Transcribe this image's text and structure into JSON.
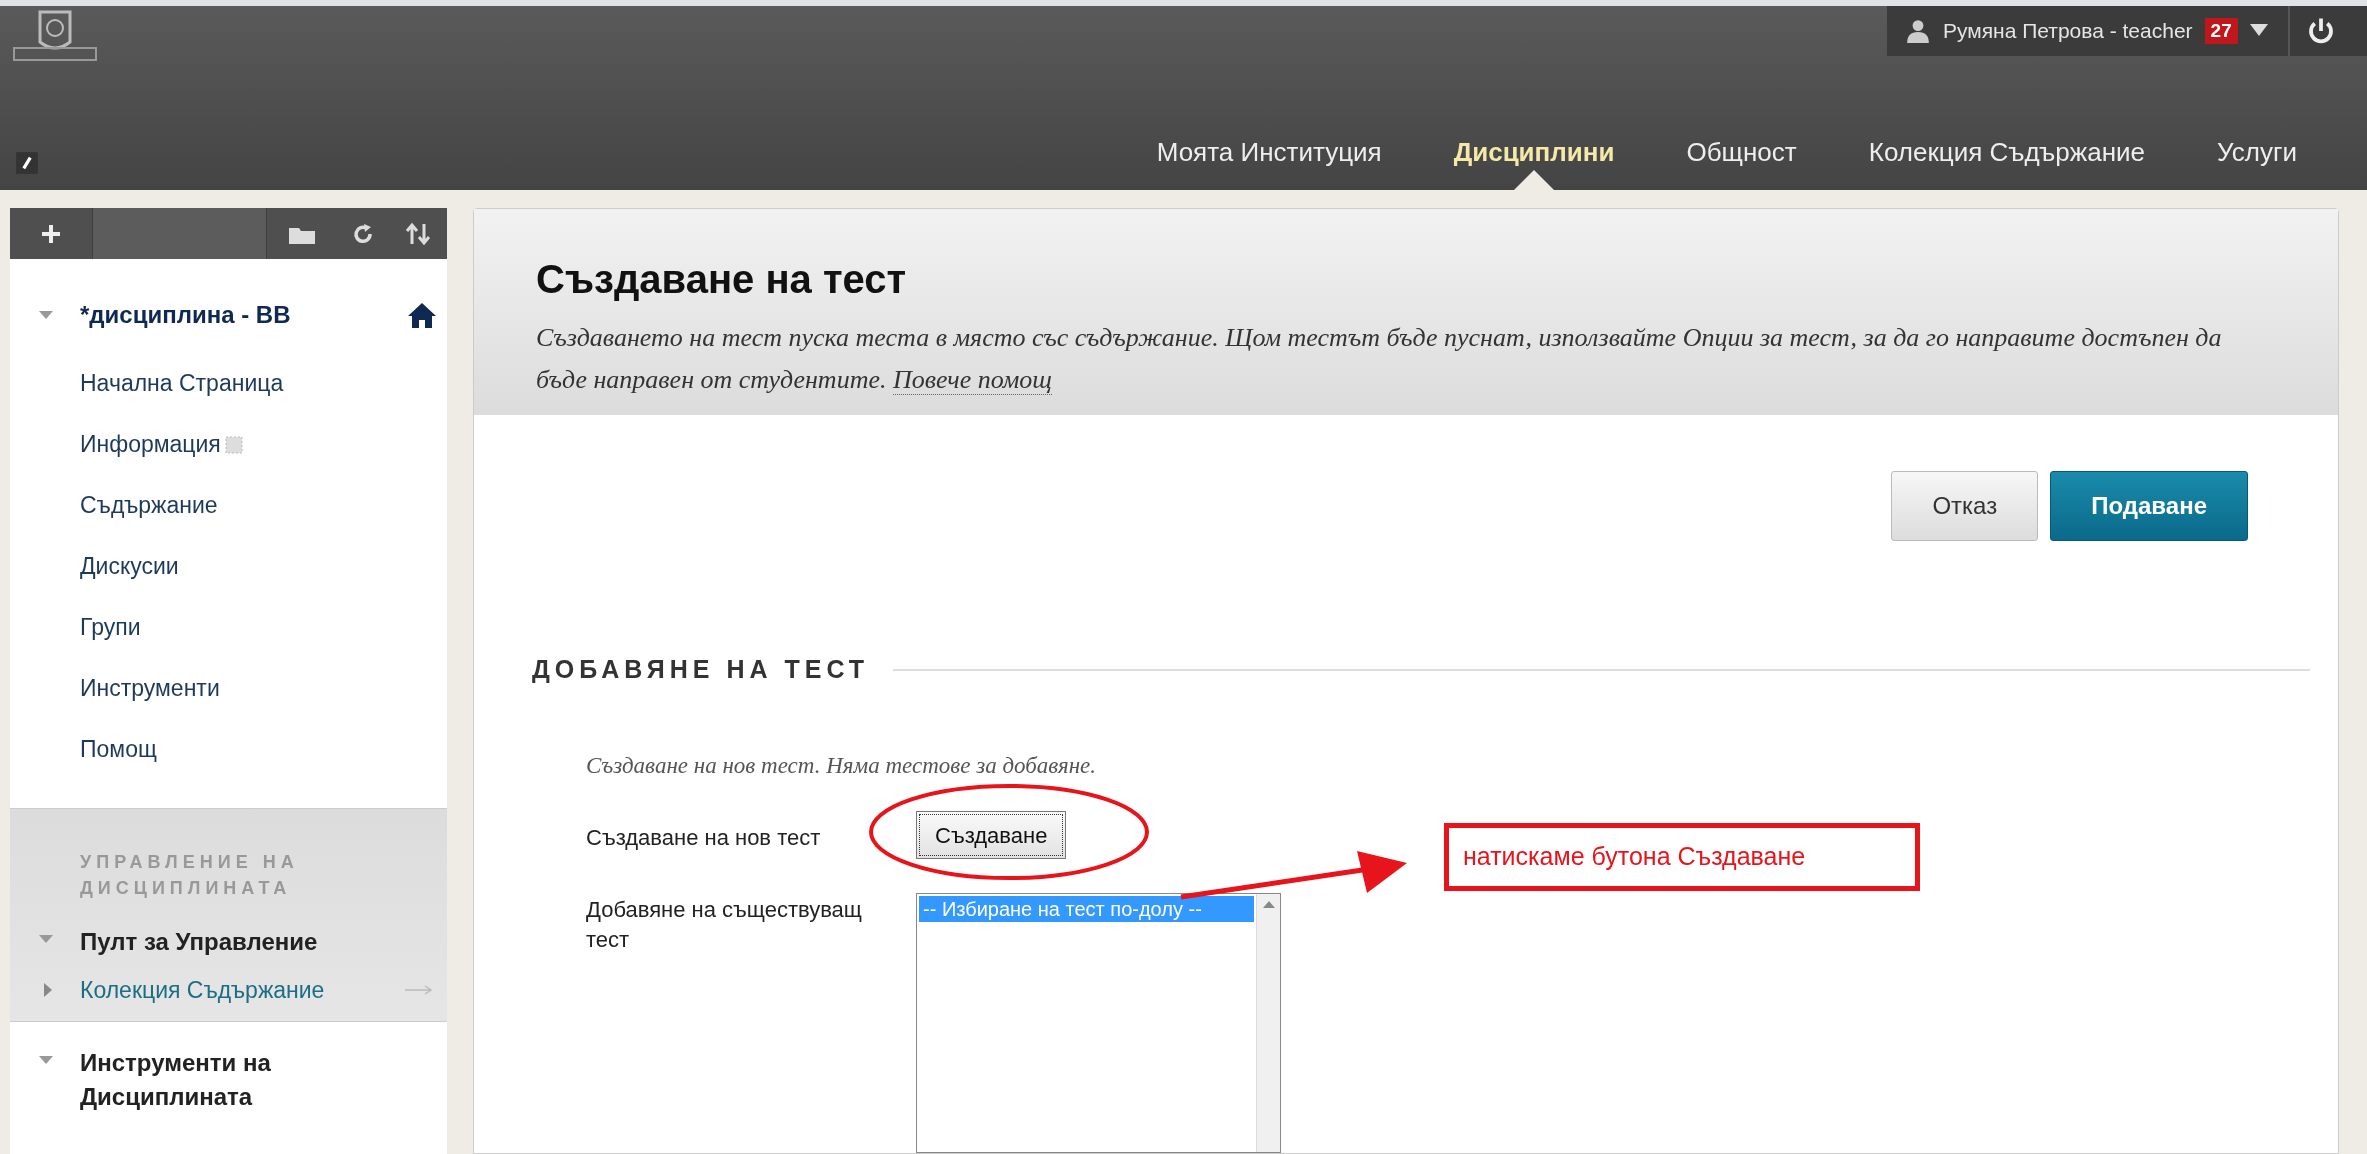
{
  "header": {
    "user": {
      "name": "Румяна Петрова - teacher",
      "badge": "27"
    },
    "nav": [
      {
        "label": "Моята Институция",
        "selected": false
      },
      {
        "label": "Дисциплини",
        "selected": true
      },
      {
        "label": "Общност",
        "selected": false
      },
      {
        "label": "Колекция Съдържание",
        "selected": false
      },
      {
        "label": "Услуги",
        "selected": false
      }
    ]
  },
  "sidebar": {
    "course": {
      "title": "*дисциплина - BB",
      "expanded": true,
      "items": [
        {
          "label": "Начална Страница",
          "kind": "link"
        },
        {
          "label": "Информация",
          "kind": "hidden"
        },
        {
          "label": "Съдържание",
          "kind": "link"
        },
        {
          "label": "Дискусии",
          "kind": "link"
        },
        {
          "label": "Групи",
          "kind": "link"
        },
        {
          "label": "Инструменти",
          "kind": "link"
        },
        {
          "label": "Помощ",
          "kind": "link"
        }
      ]
    },
    "management": {
      "title": "УПРАВЛЕНИЕ НА ДИСЦИПЛИНАТА",
      "groups": [
        {
          "label": "Пулт за Управление",
          "expanded": true,
          "children": [
            {
              "label": "Колекция Съдържание",
              "expanded": false
            }
          ]
        },
        {
          "label": "Инструменти на Дисциплината",
          "expanded": true
        }
      ]
    }
  },
  "page": {
    "title": "Създаване на тест",
    "description": "Създаването на тест пуска теста в място със съдържание. Щом тестът бъде пуснат, използвайте Опции за тест, за да го направите достъпен да бъде направен от студентите.",
    "help_link": "Повече помощ",
    "buttons": [
      {
        "label": "Отказ",
        "kind": "secondary"
      },
      {
        "label": "Подаване",
        "kind": "primary"
      }
    ],
    "section": {
      "title": "ДОБАВЯНЕ НА ТЕСТ",
      "note": "Създаване на нов тест. Няма тестове за добавяне.",
      "create": {
        "label": "Създаване на нов тест",
        "button": "Създаване"
      },
      "existing": {
        "label": "Добавяне на съществуващ тест",
        "options": [
          {
            "label": "-- Избиране на тест по-долу --",
            "selected": true
          }
        ]
      }
    }
  },
  "annotation": {
    "text": "натискаме бутона Създаване"
  }
}
